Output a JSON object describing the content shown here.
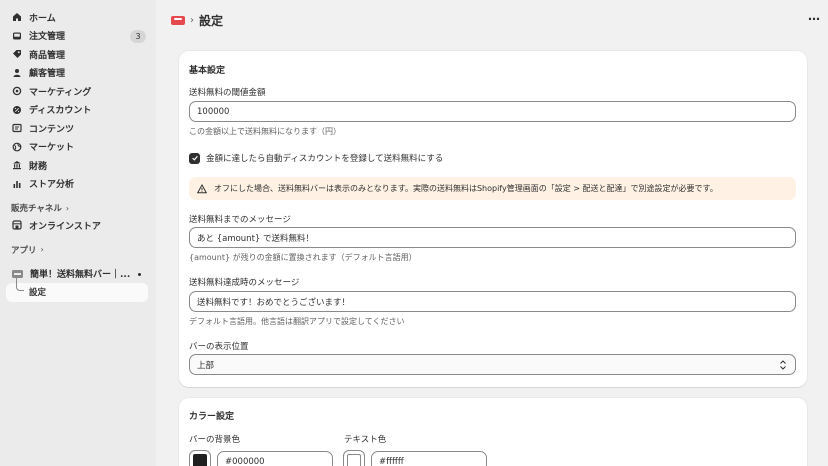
{
  "sidebar": {
    "nav": [
      {
        "label": "ホーム",
        "icon": "home-icon"
      },
      {
        "label": "注文管理",
        "icon": "inbox-icon",
        "badge": "3"
      },
      {
        "label": "商品管理",
        "icon": "tag-icon"
      },
      {
        "label": "顧客管理",
        "icon": "person-icon"
      },
      {
        "label": "マーケティング",
        "icon": "target-icon"
      },
      {
        "label": "ディスカウント",
        "icon": "discount-icon"
      },
      {
        "label": "コンテンツ",
        "icon": "content-icon"
      },
      {
        "label": "マーケット",
        "icon": "globe-icon"
      },
      {
        "label": "財務",
        "icon": "bank-icon"
      },
      {
        "label": "ストア分析",
        "icon": "chart-icon"
      }
    ],
    "sales_channels_label": "販売チャネル",
    "online_store_label": "オンラインストア",
    "apps_label": "アプリ",
    "app_name": "簡単！送料無料バー｜...",
    "app_sub_item": "設定"
  },
  "topbar": {
    "title": "設定"
  },
  "basic": {
    "title": "基本設定",
    "threshold_label": "送料無料の閾値金額",
    "threshold_value": "100000",
    "threshold_help": "この金額以上で送料無料になります（円）",
    "auto_discount_label": "金額に達したら自動ディスカウントを登録して送料無料にする",
    "auto_discount_checked": true,
    "warning_text": "オフにした場合、送料無料バーは表示のみとなります。実際の送料無料はShopify管理画面の「設定 > 配送と配達」で別途設定が必要です。",
    "progress_msg_label": "送料無料までのメッセージ",
    "progress_msg_value": "あと {amount} で送料無料！",
    "progress_msg_help": "{amount} が残りの金額に置換されます（デフォルト言語用）",
    "success_msg_label": "送料無料達成時のメッセージ",
    "success_msg_value": "送料無料です！おめでとうございます！",
    "success_msg_help": "デフォルト言語用。他言語は翻訳アプリで設定してください",
    "position_label": "バーの表示位置",
    "position_value": "上部"
  },
  "colors": {
    "title": "カラー設定",
    "bg_label": "バーの背景色",
    "bg_value": "#000000",
    "text_label": "テキスト色",
    "text_value": "#ffffff"
  }
}
